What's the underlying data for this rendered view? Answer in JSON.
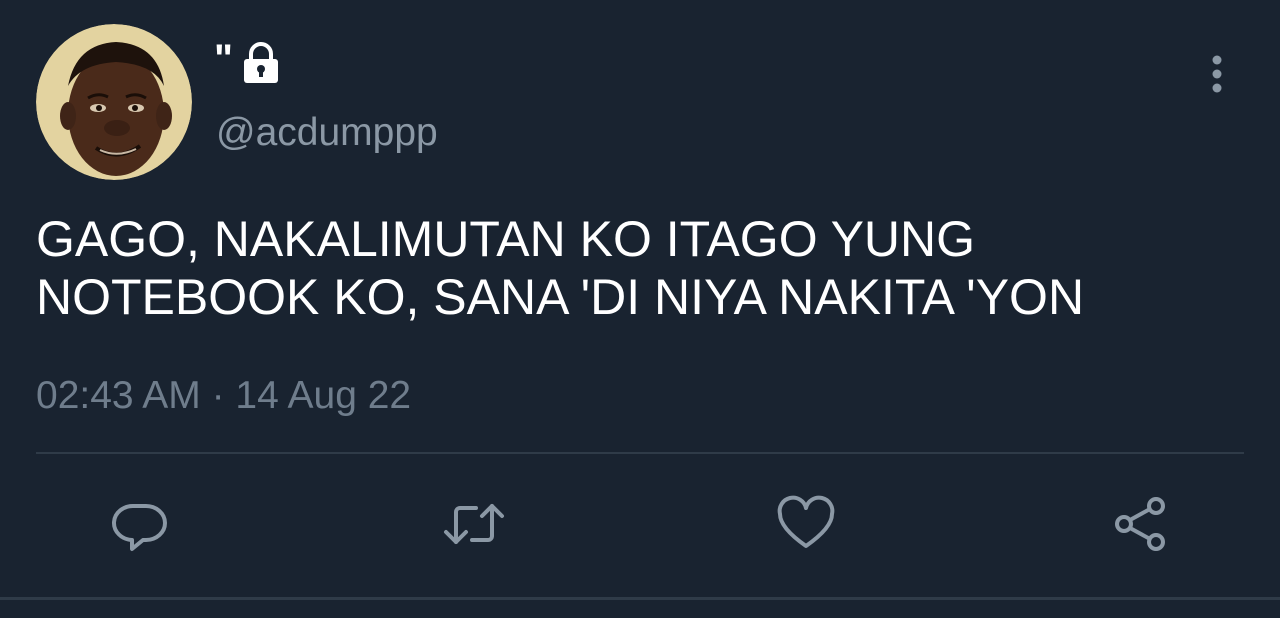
{
  "tweet": {
    "display_name": "\"",
    "handle": "@acdumppp",
    "text": "GAGO, NAKALIMUTAN KO ITAGO YUNG\nNOTEBOOK KO, SANA 'DI NIYA NAKITA 'YON",
    "timestamp": "02:43 AM · 14 Aug 22"
  },
  "icons": {
    "lock": "lock-icon",
    "menu": "more-vertical-icon",
    "reply": "reply-icon",
    "retweet": "retweet-icon",
    "like": "heart-icon",
    "share": "share-icon"
  },
  "colors": {
    "background": "#192330",
    "primary_text": "#ffffff",
    "secondary_text": "#8b98a5",
    "icon": "#8b98a5",
    "divider": "#2f3b48"
  }
}
